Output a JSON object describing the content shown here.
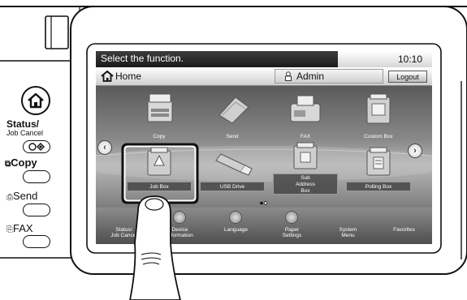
{
  "status_bar": {
    "message": "Select the function.",
    "time": "10:10"
  },
  "nav_bar": {
    "home": "Home",
    "user": "Admin",
    "logout": "Logout"
  },
  "tiles": [
    {
      "label": "Copy",
      "icon": "copy-icon"
    },
    {
      "label": "Send",
      "icon": "send-icon"
    },
    {
      "label": "FAX",
      "icon": "fax-icon"
    },
    {
      "label": "Custom Box",
      "icon": "custom-box-icon"
    },
    {
      "label": "Job Box",
      "icon": "job-box-icon"
    },
    {
      "label": "USB Drive",
      "icon": "usb-drive-icon"
    },
    {
      "label": "Sub Address Box",
      "label_lines": [
        "Sub",
        "Address",
        "Box"
      ],
      "icon": "sub-address-box-icon"
    },
    {
      "label": "Polling Box",
      "icon": "polling-box-icon"
    }
  ],
  "dock": [
    {
      "line1": "Status/",
      "line2": "Job Cancel"
    },
    {
      "line1": "Device",
      "line2": "Information"
    },
    {
      "line1": "Language",
      "line2": ""
    },
    {
      "line1": "Paper",
      "line2": "Settings"
    },
    {
      "line1": "System",
      "line2": "Menu"
    },
    {
      "line1": "Favorites",
      "line2": ""
    }
  ],
  "side_panel": {
    "status_line1": "Status/",
    "status_line2": "Job Cancel",
    "copy": "Copy",
    "send": "Send",
    "fax": "FAX"
  },
  "colors": {
    "screen_bg": "#6e6e6e",
    "status_bar": "#1a1a1a",
    "selection": "#ffffff"
  }
}
